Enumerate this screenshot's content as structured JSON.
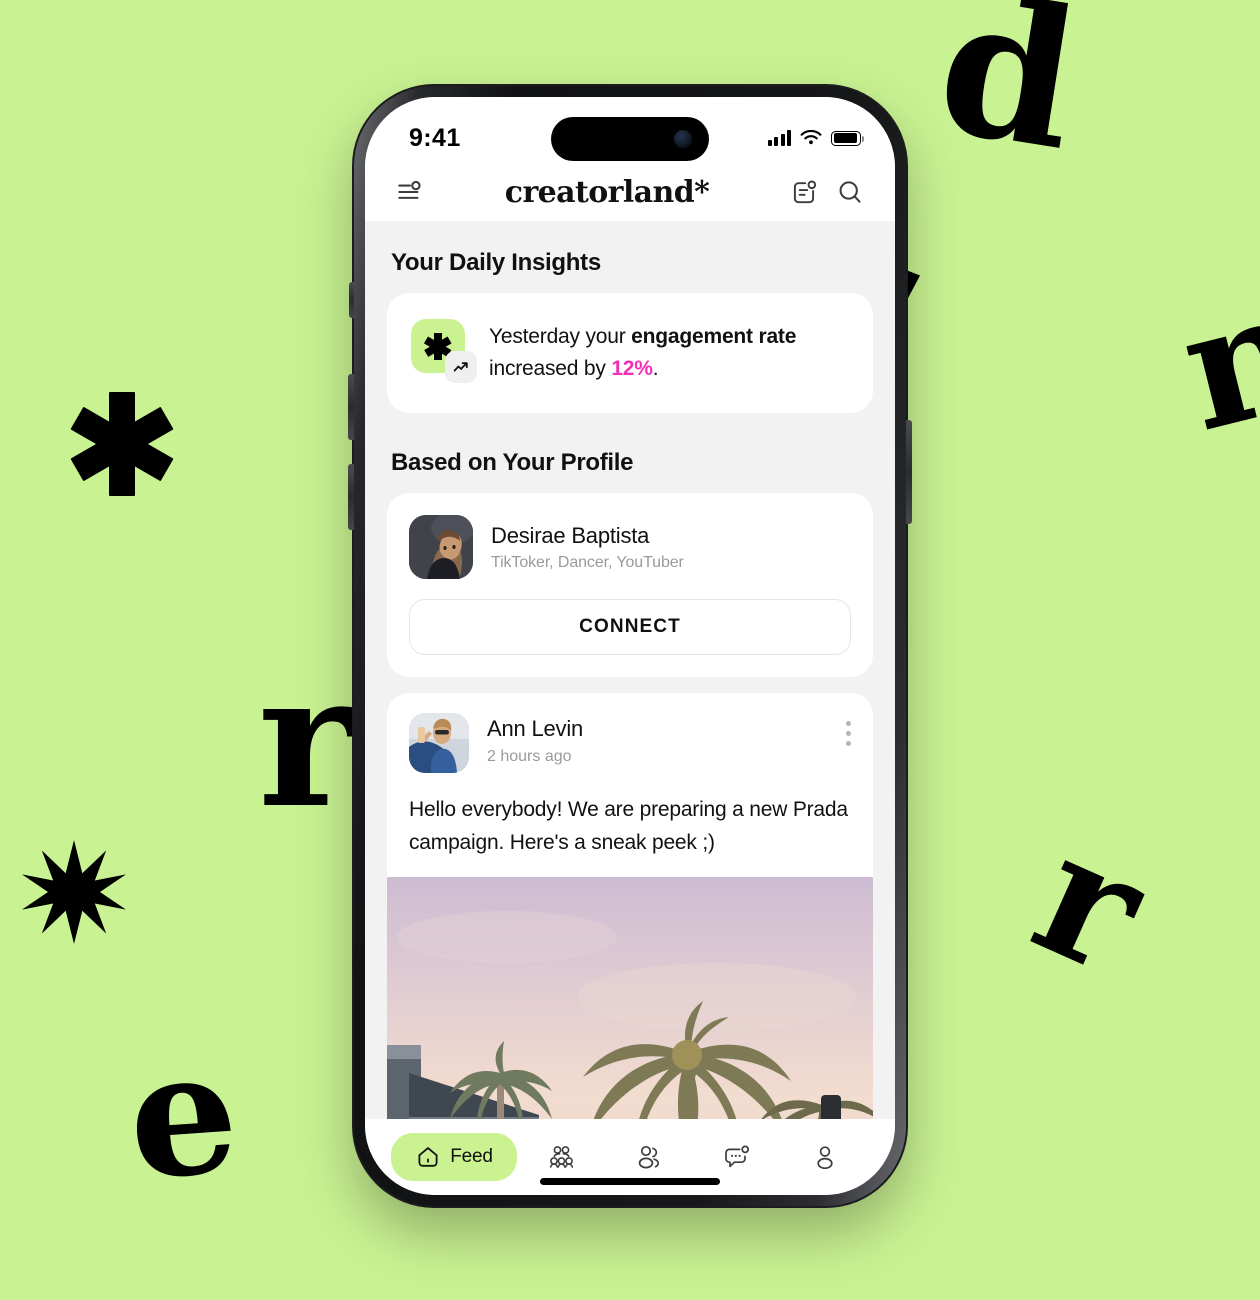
{
  "background": {
    "color": "#c9f392",
    "decorative_glyphs": [
      "d",
      "n",
      "r",
      "r",
      "e"
    ],
    "decorative_shapes": [
      "asterisk",
      "ten-point-star"
    ]
  },
  "phone": {
    "status_bar": {
      "time": "9:41",
      "icons": [
        "cellular-signal-icon",
        "wifi-icon",
        "battery-icon"
      ]
    },
    "home_indicator": true
  },
  "app": {
    "header": {
      "menu_icon": "filter-lines-icon",
      "logo": "creatorland*",
      "notifications_icon": "news-badge-icon",
      "search_icon": "search-icon"
    },
    "sections": {
      "insights": {
        "title": "Your Daily Insights",
        "card": {
          "badge_icon": "asterisk-icon",
          "chip_icon": "trend-up-icon",
          "text_parts": [
            {
              "text": "Yesterday your ",
              "style": "normal"
            },
            {
              "text": "engagement rate",
              "style": "bold"
            },
            {
              "text": " increased by ",
              "style": "normal"
            },
            {
              "text": "12%",
              "style": "highlight"
            },
            {
              "text": ".",
              "style": "normal"
            }
          ],
          "plain_text": "Yesterday your engagement rate increased by 12%.",
          "highlight_color": "#f02fbb",
          "badge_color": "#caf290"
        }
      },
      "profile_suggestion": {
        "title": "Based on Your Profile",
        "card": {
          "avatar": "creator-avatar",
          "name": "Desirae Baptista",
          "tags": "TikToker, Dancer, YouTuber",
          "connect_label": "CONNECT"
        }
      },
      "post": {
        "avatar": "author-avatar",
        "author": "Ann Levin",
        "timestamp": "2 hours ago",
        "menu_icon": "kebab-menu-icon",
        "body": "Hello everybody! We are preparing a new Prada campaign. Here's a sneak peek ;)",
        "image_alt": "palm trees at sunset"
      }
    },
    "tabbar": {
      "items": [
        {
          "label": "Feed",
          "icon": "home-icon",
          "active": true
        },
        {
          "label": "",
          "icon": "community-icon",
          "active": false
        },
        {
          "label": "",
          "icon": "connections-icon",
          "active": false
        },
        {
          "label": "",
          "icon": "chat-badge-icon",
          "active": false
        },
        {
          "label": "",
          "icon": "person-icon",
          "active": false
        }
      ],
      "active_color": "#caf290"
    }
  }
}
